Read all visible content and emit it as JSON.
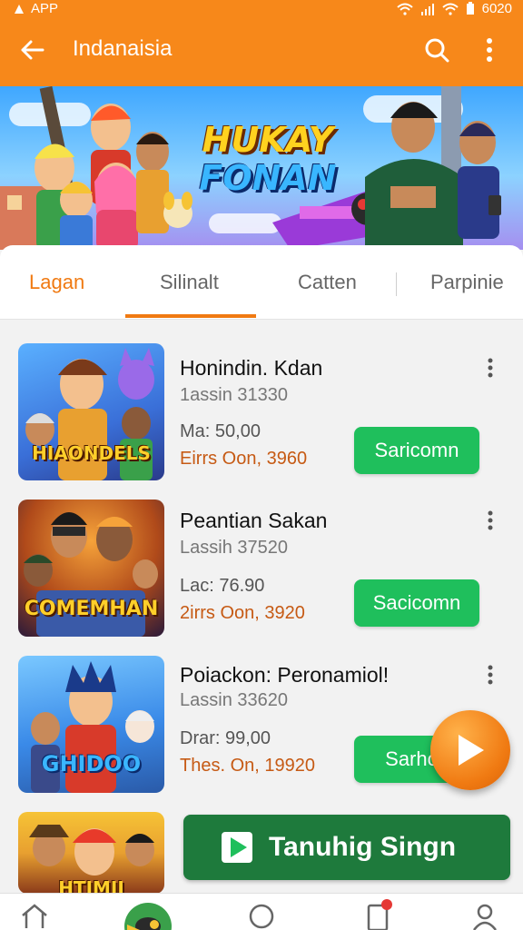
{
  "status_bar": {
    "app_label": "APP",
    "time": "6020"
  },
  "app_bar": {
    "title": "Indanaisia"
  },
  "banner": {
    "line1": "HUKAY",
    "line2": "FONAN"
  },
  "tabs": [
    {
      "label": "Lagan",
      "active": true
    },
    {
      "label": "Silinalt",
      "active": false
    },
    {
      "label": "Catten",
      "active": false
    },
    {
      "label": "Parpinie",
      "active": false
    }
  ],
  "items": [
    {
      "title": "Ηonindin. Kdan",
      "subtitle": "1assin 31330",
      "meta": "Ma: 50,00",
      "price": "Eirrs Oon,  3960",
      "action": "Saricomn",
      "thumb_text": "HIAONDELS"
    },
    {
      "title": "Peantian Sakan",
      "subtitle": "Lassih 37520",
      "meta": "Lac: 76.90",
      "price": "2irrs Oon,  3920",
      "action": "Sacicomn",
      "thumb_text": "COMEMHAN"
    },
    {
      "title": "Poiackon: Peronamiol!",
      "subtitle": "Lassin 33620",
      "meta": "Drar: 99,00",
      "price": "Thes. On,  19920",
      "action": "Sarhoc",
      "thumb_text": "GHIDOO"
    },
    {
      "title": "",
      "subtitle": "",
      "meta": "",
      "price": "",
      "action": "",
      "thumb_text": "HTIMII"
    }
  ],
  "cta": {
    "label": "Tanuhig Singn"
  },
  "colors": {
    "accent": "#f7881a",
    "green": "#1fbf5c",
    "dark_green": "#1e7a3c",
    "price": "#c65a14"
  },
  "icons": [
    "back-arrow-icon",
    "search-icon",
    "more-vert-icon",
    "play-icon",
    "home-icon",
    "circle-icon",
    "bookmark-icon",
    "profile-icon"
  ]
}
